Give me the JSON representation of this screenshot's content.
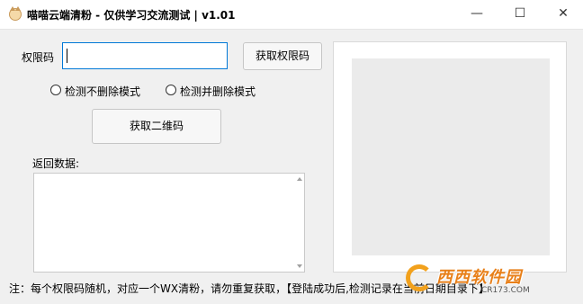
{
  "window": {
    "title": "喵喵云端清粉 - 仅供学习交流测试 | v1.01",
    "minimize_glyph": "—",
    "maximize_glyph": "☐",
    "close_glyph": "✕",
    "icon": "cat-icon"
  },
  "form": {
    "code_label": "权限码",
    "code_value": "",
    "get_code_button": "获取权限码",
    "radio_options": [
      "检测不删除模式",
      "检测并删除模式"
    ],
    "get_qr_button": "获取二维码",
    "return_label": "返回数据:",
    "return_value": ""
  },
  "footer": {
    "notice": "注：每个权限码随机，对应一个WX清粉，请勿重复获取，【登陆成功后,检测记录在当前日期目录下】"
  },
  "watermark": {
    "text": "西西软件园",
    "sub": "CR173.COM"
  },
  "colors": {
    "accent": "#0078d7",
    "watermark": "#e8801a"
  }
}
